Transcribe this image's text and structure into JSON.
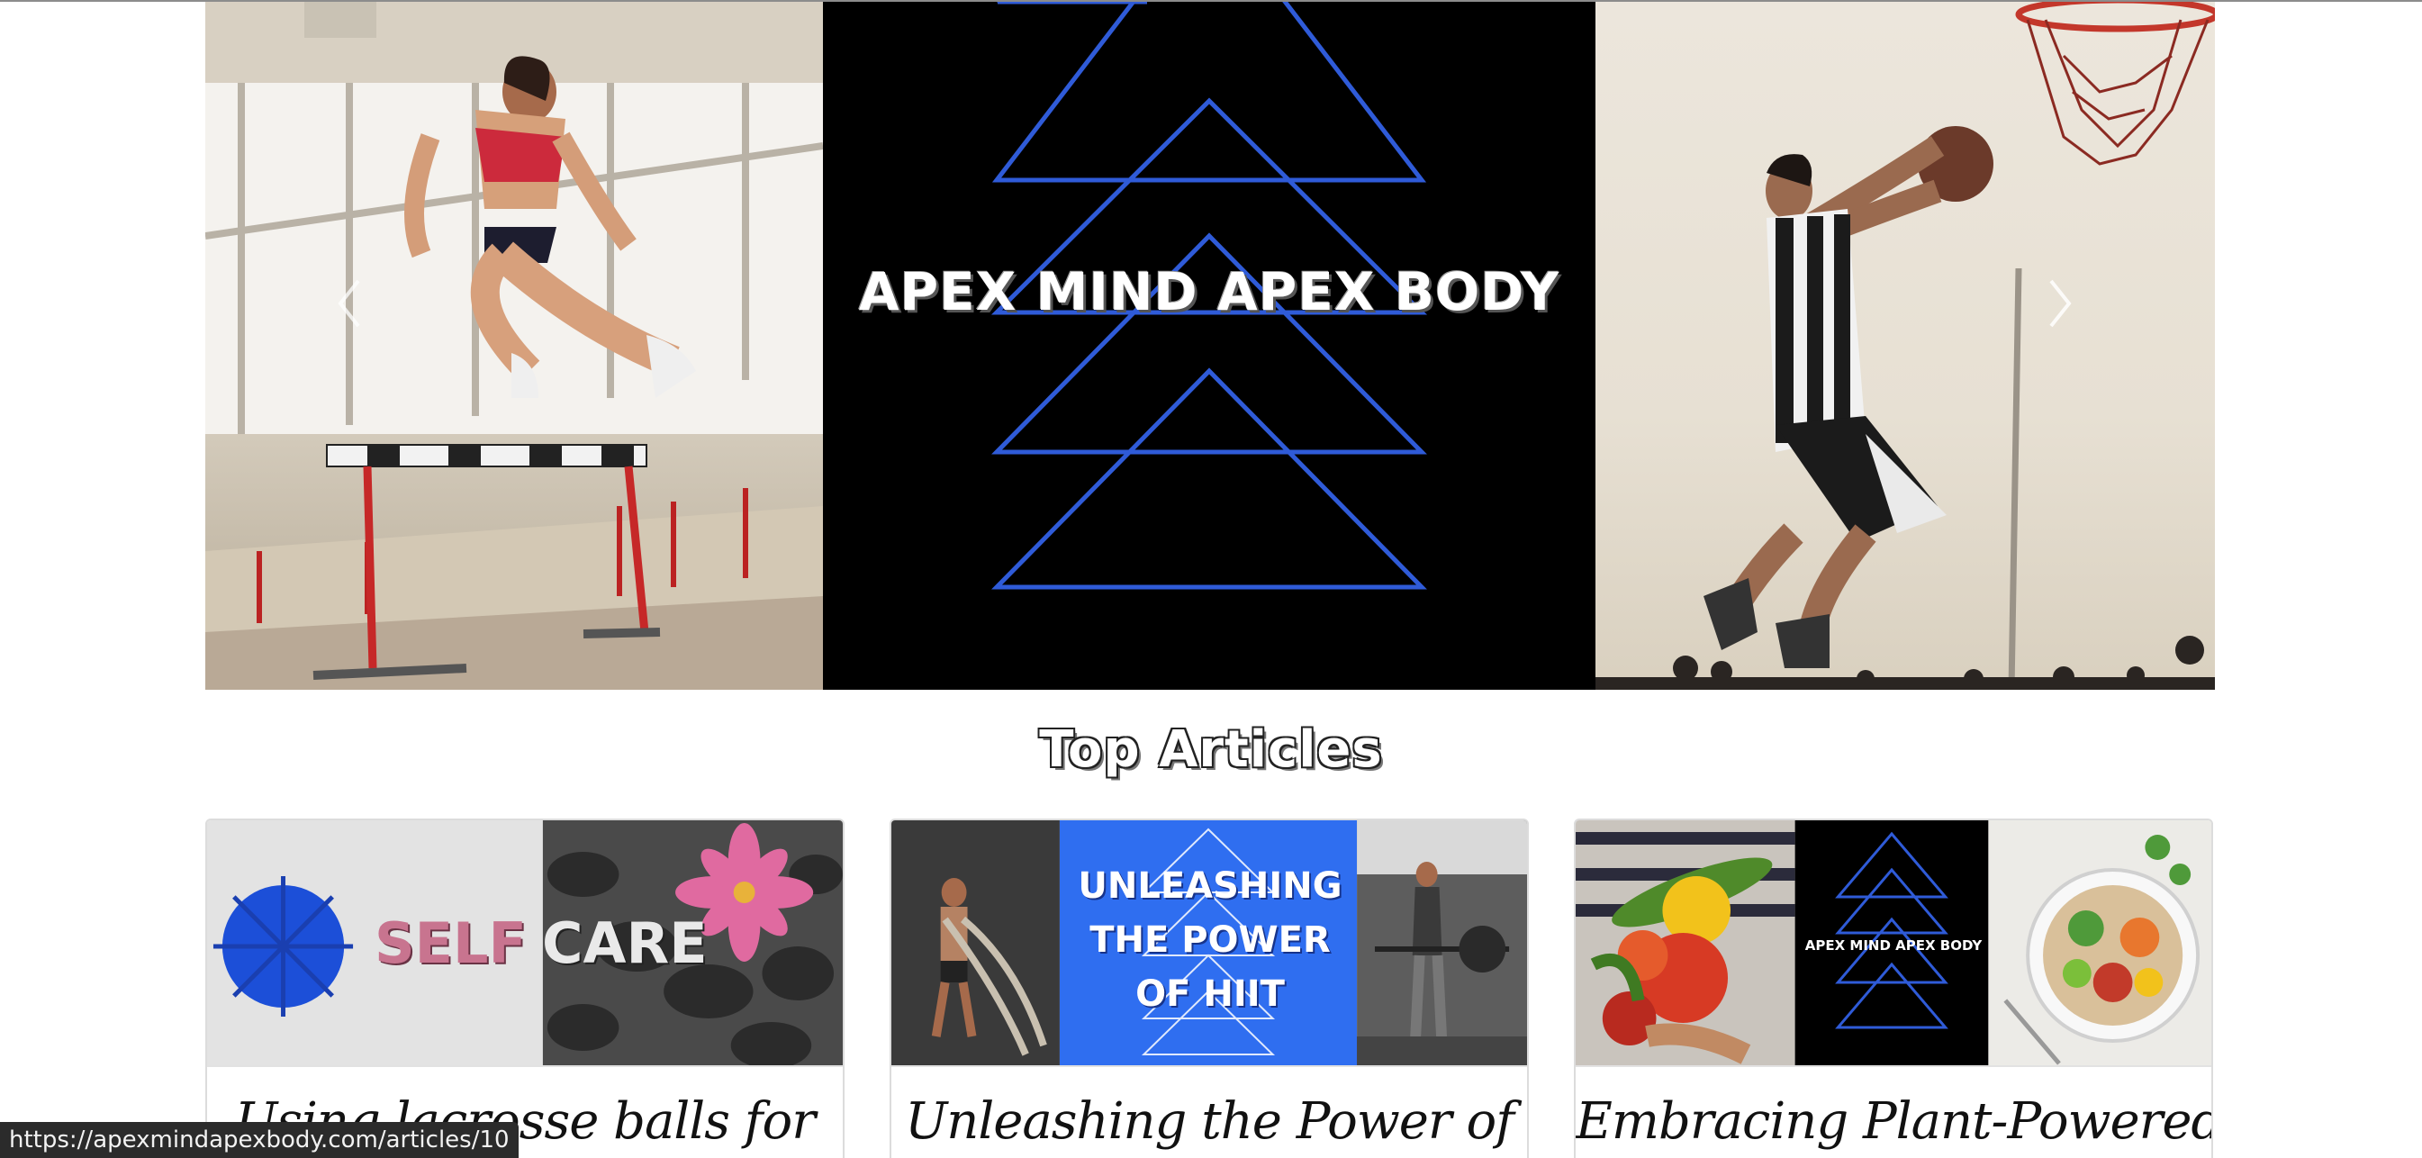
{
  "hero": {
    "title": "APEX MIND APEX BODY",
    "slides": [
      {
        "label": "hurdle-athlete-photo"
      },
      {
        "label": "apex-logo-slide"
      },
      {
        "label": "basketball-player-photo"
      }
    ],
    "active_slide": 1,
    "colors": {
      "accent_blue": "#2f5bd8",
      "background": "#000000"
    }
  },
  "section": {
    "heading": "Top Articles"
  },
  "articles": [
    {
      "title": "Using lacrosse balls for",
      "image_word_1": "SELF",
      "image_word_2": "CARE",
      "href": "https://apexmindapexbody.com/articles/10"
    },
    {
      "title": "Unleashing the Power of",
      "image_line_1": "UNLEASHING",
      "image_line_2": "THE POWER",
      "image_line_3": "OF HIIT"
    },
    {
      "title": "Embracing Plant-Powered",
      "image_logo_text": "APEX MIND APEX BODY"
    }
  ],
  "status_bar": {
    "url": "https://apexmindapexbody.com/articles/10"
  }
}
